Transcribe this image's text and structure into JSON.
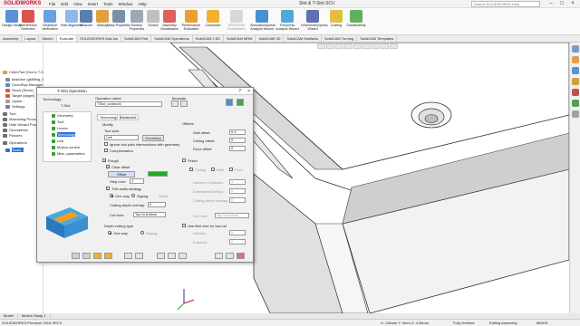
{
  "app": {
    "logo": "SOLIDWORKS",
    "title": "Slot & T-Slot.SCU",
    "search_placeholder": "Search SOLIDWORKS Help",
    "menu": [
      "File",
      "Edit",
      "View",
      "Insert",
      "Tools",
      "Window",
      "Help"
    ]
  },
  "toolbar": {
    "commands": [
      "Interference Detection",
      "Clearance Verification",
      "Hole Alignment",
      "Measure",
      "Markup",
      "Mass Properties",
      "Section Properties",
      "Sensor",
      "Assembly Visualization",
      "Performance Evaluation",
      "Customize",
      "SPEEDPAK Instantiation",
      "SimulationXpress Analysis Wizard",
      "FloXpress Analysis Wizard",
      "DriveWorksXpress Wizard",
      "Costing",
      "Sustainability"
    ],
    "left_button": "Design Study"
  },
  "tabs": [
    "Assembly",
    "Layout",
    "Sketch",
    "Evaluate",
    "SOLIDWORKS Add-Ins",
    "SolidCAM Part",
    "SolidCAM Operations",
    "SolidCAM 2.5D",
    "SolidCAM MRM",
    "SolidCAM 3D",
    "SolidCAM Multiaxis",
    "SolidCAM Turning",
    "SolidCAM Templates"
  ],
  "tree": [
    "CAM-Part (Slot & T-Slot.SCU)",
    "Machine (gMilling_Haas_SS_3X)",
    "CoordSys Manager",
    "Stock (Stock)",
    "Target (target)",
    "Updat...",
    "Settings",
    "Tool",
    "Machining Process",
    "Hole Wizard Process",
    "Geometries",
    "Pictures",
    "Operations",
    "ToolA..."
  ],
  "dialog": {
    "title": "T-Slot Operation",
    "technology_label": "Technology:",
    "technology_value": "T-Slot",
    "operation_name_label": "Operation name",
    "operation_name_value": "TSlot_contour1",
    "template_label": "Template",
    "nav": [
      "Geometry",
      "Tool",
      "Levels",
      "Technology",
      "Link",
      "Motion control",
      "Misc. parameters"
    ],
    "inner_tabs": [
      "Technology",
      "Advanced"
    ],
    "modify_label": "Modify",
    "tool_side_label": "Tool side:",
    "tool_side_value": "Left",
    "geometry_button": "Geometry",
    "ignore_tool_path": "Ignore tool path intersections with geometry",
    "compensation": "Compensation",
    "rough_label": "Rough",
    "clear_offset": "Clear offset",
    "offset_button": "Offset",
    "step_over_label": "Step over:",
    "step_over_value": "1",
    "thin_walls": "Thin walls strategy",
    "one_way": "One way",
    "zigzag": "Zigzag",
    "spiral": "Spiral",
    "cutting_depth_overlap_label": "Cutting depth overlap:",
    "cutting_depth_overlap_value": "0",
    "cut_from_label": "Cut from:",
    "cut_from_value": "Top to bottom",
    "depth_cutting_type": "Depth cutting type",
    "depth_one_way": "One way",
    "depth_zigzag": "Zigzag",
    "offsets_label": "Offsets",
    "wall_offset_label": "Wall offset:",
    "wall_offset_value": "0.5",
    "ceiling_offset_label": "Ceiling offset:",
    "ceiling_offset_value": "0",
    "floor_offset_label": "Floor offset:",
    "floor_offset_value": "0",
    "finish_label": "Finish",
    "finish_ceiling": "Ceiling",
    "finish_wall": "Wall",
    "finish_floor": "Floor",
    "num_passes_label": "Number of passes:",
    "num_passes_value": "1",
    "extension_label": "Extension/Overlap:",
    "extension_value": "0",
    "finish_overlap_label": "Cutting depth overlap:",
    "finish_overlap_value": "0",
    "finish_cut_from_label": "Cut from:",
    "finish_cut_from_value": "Top to bottom",
    "fillet_size": "Use fillet size for last cut",
    "internal_label": "Internal:",
    "internal_value": "0",
    "external_label": "External:",
    "external_value": "0"
  },
  "modeltabs": [
    "Model",
    "Motion Study 1"
  ],
  "status": {
    "left": "SOLIDWORKS Premium 2018 SP2.0",
    "coords": "X: 148mm Y: 9mm Z: 4.50mm",
    "defined": "Fully Defined",
    "editing": "Editing Assembly",
    "units": "MMGS"
  },
  "colors": {
    "accent": "#2a6fd6",
    "logo": "#c8102e",
    "offset_green": "#22aa22"
  }
}
